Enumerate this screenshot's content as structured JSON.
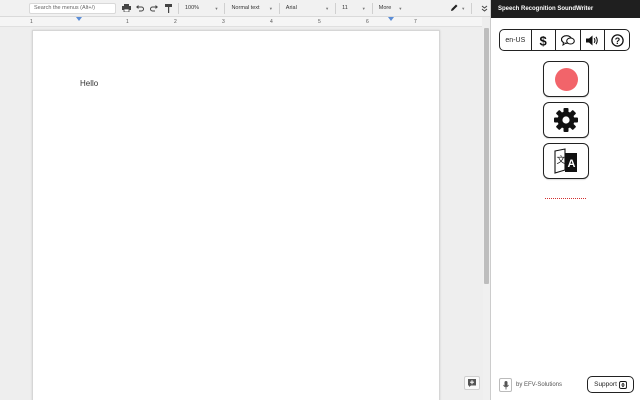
{
  "toolbar": {
    "search_placeholder": "Search the menus (Alt+/)",
    "zoom": "100%",
    "style": "Normal text",
    "font": "Arial",
    "font_size": "11",
    "more": "More"
  },
  "ruler": {
    "numbers": [
      "1",
      "1",
      "2",
      "3",
      "4",
      "5",
      "6",
      "7"
    ]
  },
  "document": {
    "text": "Hello"
  },
  "panel": {
    "title": "Speech Recognition SoundWriter",
    "language": "en-US",
    "icons": [
      "dollar-icon",
      "speech-bubbles-icon",
      "speaker-icon",
      "help-icon"
    ],
    "record_color": "#f2646a",
    "footer_text": "by EFV-Solutions",
    "support_label": "Support"
  }
}
